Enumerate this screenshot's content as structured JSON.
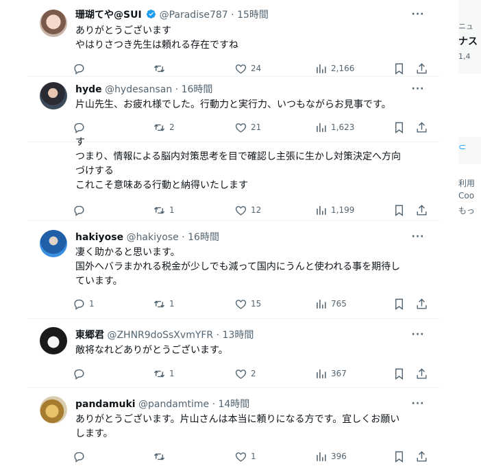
{
  "tweets": [
    {
      "id": 1,
      "name": "珊瑚てや@SUI",
      "verified": true,
      "handle": "@Paradise787",
      "time": "15時間",
      "lines": [
        "ありがとうございます",
        "やはりさつき先生は頼れる存在ですね"
      ],
      "reply": "",
      "retweet": "",
      "like": "24",
      "views": "2,166"
    },
    {
      "id": 2,
      "name": "hyde",
      "verified": false,
      "handle": "@hydesansan",
      "time": "16時間",
      "lines": [
        "片山先生、お疲れ様でした。行動力と実行力、いつもながらお見事です。"
      ],
      "reply": "",
      "retweet": "2",
      "like": "21",
      "views": "1,623"
    },
    {
      "id": 3,
      "lines": [
        "つまり、情報による脳内対策思考を目で確認し主張に生かし対策決定へ方向",
        "づけする",
        "これこそ意味ある行動と納得いたします"
      ],
      "partial_top": "す",
      "reply": "",
      "retweet": "1",
      "like": "12",
      "views": "1,199"
    },
    {
      "id": 4,
      "name": "hakiyose",
      "verified": false,
      "handle": "@hakiyose",
      "time": "16時間",
      "lines": [
        "凄く助かると思います。",
        "国外へバラまかれる税金が少しでも減って国内にうんと使われる事を期待し",
        "ています。"
      ],
      "reply": "1",
      "retweet": "1",
      "like": "15",
      "views": "765"
    },
    {
      "id": 5,
      "name": "東郷君",
      "verified": false,
      "handle": "@ZHNR9doSsXvmYFR",
      "time": "13時間",
      "lines": [
        "敵将なれどありがとうございます。"
      ],
      "reply": "",
      "retweet": "1",
      "like": "2",
      "views": "367"
    },
    {
      "id": 6,
      "name": "pandamuki",
      "verified": false,
      "handle": "@pandamtime",
      "time": "14時間",
      "lines": [
        "ありがとうございます。片山さんは本当に頼りになる方です。宜しくお願い",
        "します。"
      ],
      "reply": "",
      "retweet": "",
      "like": "1",
      "views": "396"
    }
  ],
  "sidebar": {
    "top_fragment": "ニュ",
    "title_fragment": "ナス",
    "count_fragment": "1,4",
    "footer_line1": "利用",
    "footer_line2": "Coo",
    "footer_line3": "もっ"
  },
  "colors": {
    "verified": "#1d9bf0",
    "text": "#0f1419",
    "muted": "#536471"
  }
}
